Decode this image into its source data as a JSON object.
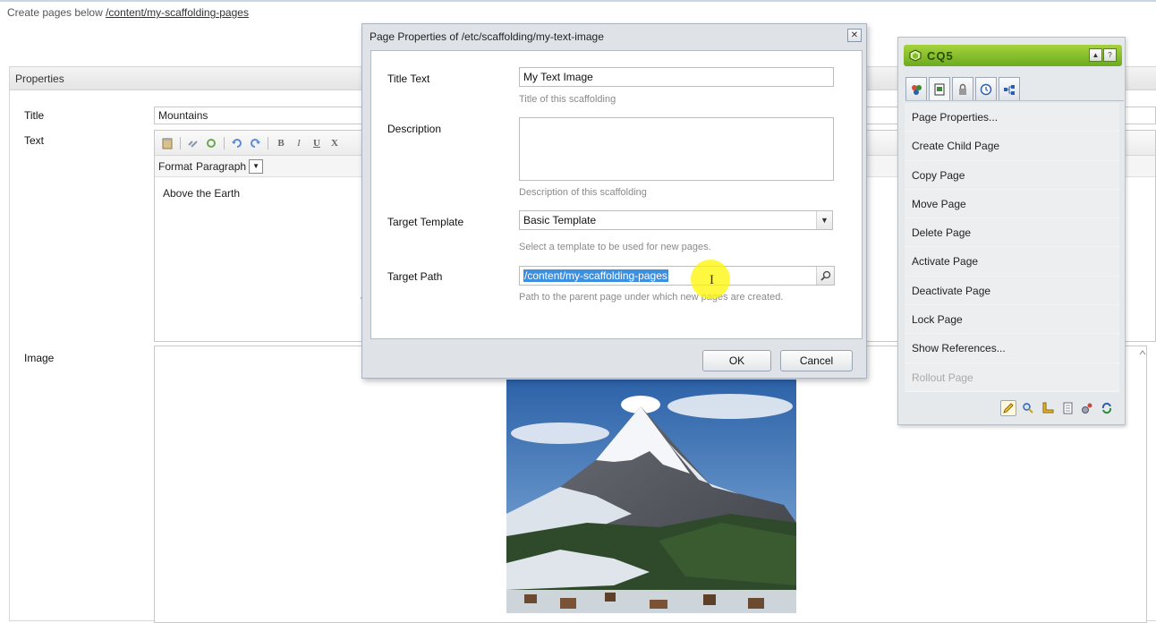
{
  "create_line": {
    "prefix": "Create pages below ",
    "link": "/content/my-scaffolding-pages"
  },
  "props": {
    "header": "Properties",
    "title_label": "Title",
    "title_value": "Mountains",
    "text_label": "Text",
    "format_label": "Format",
    "format_value": "Paragraph",
    "text_content": "Above the Earth",
    "image_label": "Image"
  },
  "dialog": {
    "title": "Page Properties of /etc/scaffolding/my-text-image",
    "title_text_label": "Title Text",
    "title_text_value": "My Text Image",
    "title_text_hint": "Title of this scaffolding",
    "description_label": "Description",
    "description_value": "",
    "description_hint": "Description of this scaffolding",
    "target_template_label": "Target Template",
    "target_template_value": "Basic Template",
    "target_template_hint": "Select a template to be used for new pages.",
    "target_path_label": "Target Path",
    "target_path_value": "/content/my-scaffolding-pages",
    "target_path_hint": "Path to the parent page under which new pages are created.",
    "ok_label": "OK",
    "cancel_label": "Cancel"
  },
  "sidekick": {
    "logo": "CQ5",
    "items": [
      {
        "label": "Page Properties...",
        "enabled": true
      },
      {
        "label": "Create Child Page",
        "enabled": true
      },
      {
        "label": "Copy Page",
        "enabled": true
      },
      {
        "label": "Move Page",
        "enabled": true
      },
      {
        "label": "Delete Page",
        "enabled": true
      },
      {
        "label": "Activate Page",
        "enabled": true
      },
      {
        "label": "Deactivate Page",
        "enabled": true
      },
      {
        "label": "Lock Page",
        "enabled": true
      },
      {
        "label": "Show References...",
        "enabled": true
      },
      {
        "label": "Rollout Page",
        "enabled": false
      }
    ],
    "tab_icons": [
      "components-icon",
      "page-icon",
      "lock-icon",
      "versioning-icon",
      "workflow-icon"
    ],
    "footer_icons": [
      "edit-pencil-icon",
      "preview-magnifier-icon",
      "design-ruler-icon",
      "document-icon",
      "settings-gear-icon",
      "refresh-icon"
    ]
  },
  "colors": {
    "accent_green": "#7fbf27",
    "selection_blue": "#3d8fe0",
    "arrow_blue": "#2a74d6",
    "highlight_yellow": "#fff200"
  }
}
